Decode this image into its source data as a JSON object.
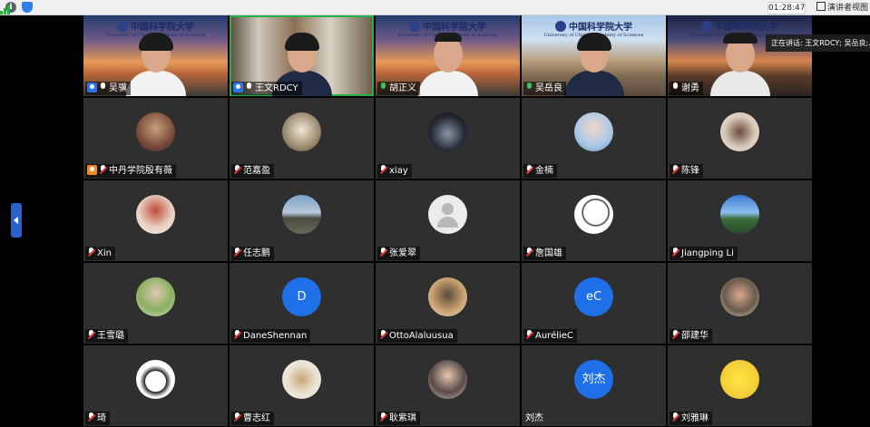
{
  "toolbar": {
    "timer": "01:28:47",
    "view_label": "演讲者视图"
  },
  "speaking_now": "正在讲话: 王文RDCY; 吴岳良;...",
  "banner": {
    "title": "中国科学院大学",
    "subtitle": "University of Chinese Academy of Sciences"
  },
  "participants": [
    {
      "name": "吴骥",
      "kind": "video",
      "badge": "host"
    },
    {
      "name": "王文RDCY",
      "kind": "video",
      "badge": "host",
      "active": true
    },
    {
      "name": "胡正义",
      "kind": "video"
    },
    {
      "name": "吴岳良",
      "kind": "video"
    },
    {
      "name": "谢勇",
      "kind": "video"
    },
    {
      "name": "中丹学院殷有薇",
      "kind": "avatar",
      "badge": "cohost"
    },
    {
      "name": "范嘉盈",
      "kind": "avatar"
    },
    {
      "name": "xiay",
      "kind": "avatar"
    },
    {
      "name": "金楠",
      "kind": "avatar"
    },
    {
      "name": "陈锋",
      "kind": "avatar"
    },
    {
      "name": "Xin",
      "kind": "avatar"
    },
    {
      "name": "任志鹏",
      "kind": "avatar"
    },
    {
      "name": "张爱翠",
      "kind": "default"
    },
    {
      "name": "詹国雄",
      "kind": "avatar"
    },
    {
      "name": "Jiangping Li",
      "kind": "avatar"
    },
    {
      "name": "王雪璐",
      "kind": "avatar"
    },
    {
      "name": "DaneShennan",
      "kind": "letter",
      "letter": "D"
    },
    {
      "name": "OttoAlaluusua",
      "kind": "avatar"
    },
    {
      "name": "AurélieC",
      "kind": "letter",
      "letter": "eC"
    },
    {
      "name": "邵建华",
      "kind": "avatar"
    },
    {
      "name": "琦",
      "kind": "avatar"
    },
    {
      "name": "曹志红",
      "kind": "avatar"
    },
    {
      "name": "耿紫琪",
      "kind": "avatar"
    },
    {
      "name": "刘杰",
      "kind": "letter",
      "letter": "刘杰",
      "plain": true
    },
    {
      "name": "刘雅琳",
      "kind": "avatar"
    }
  ]
}
